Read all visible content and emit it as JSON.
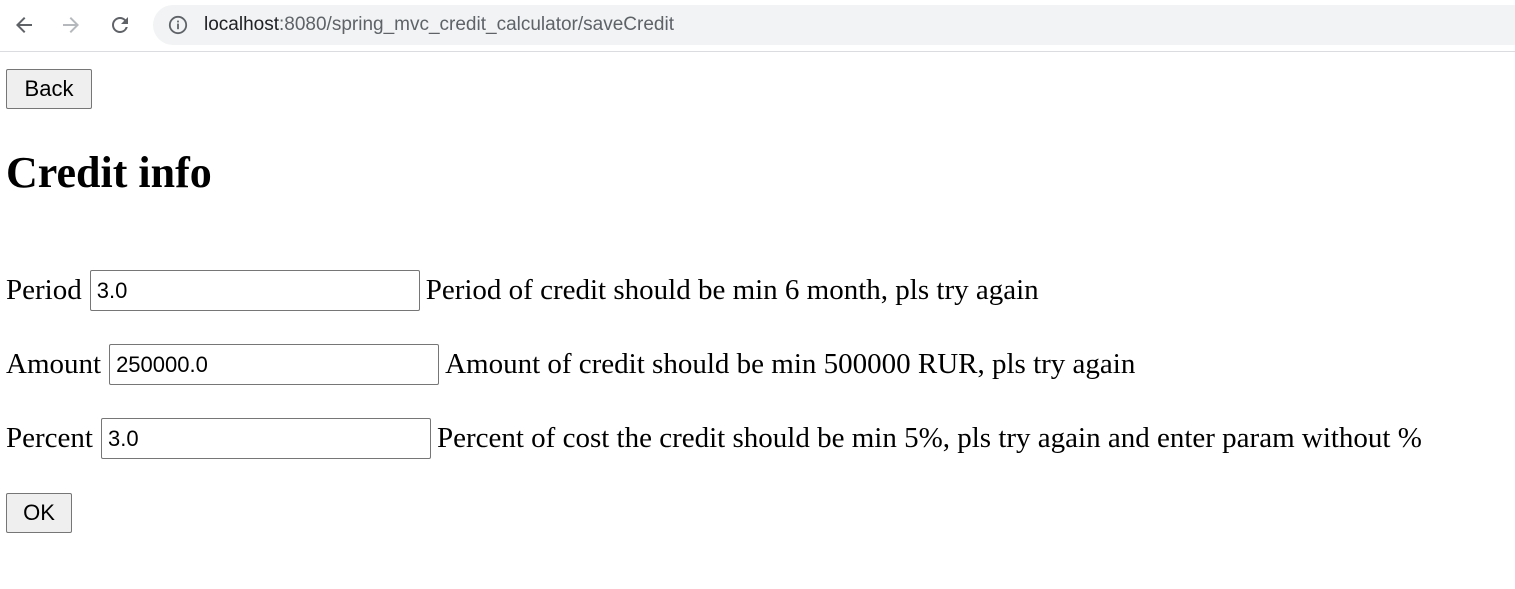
{
  "browser": {
    "url_host": "localhost",
    "url_rest": ":8080/spring_mvc_credit_calculator/saveCredit",
    "icons": {
      "back": "arrow-left-icon",
      "forward": "arrow-right-icon",
      "reload": "reload-icon",
      "site_info": "info-icon"
    }
  },
  "page": {
    "back_label": "Back",
    "title": "Credit info",
    "fields": [
      {
        "label": "Period",
        "value": "3.0",
        "error": "Period of credit should be min 6 month, pls try again"
      },
      {
        "label": "Amount",
        "value": "250000.0",
        "error": "Amount of credit should be min 500000 RUR, pls try again"
      },
      {
        "label": "Percent",
        "value": "3.0",
        "error": "Percent of cost the credit should be min 5%, pls try again and enter param without %"
      }
    ],
    "ok_label": "OK"
  }
}
